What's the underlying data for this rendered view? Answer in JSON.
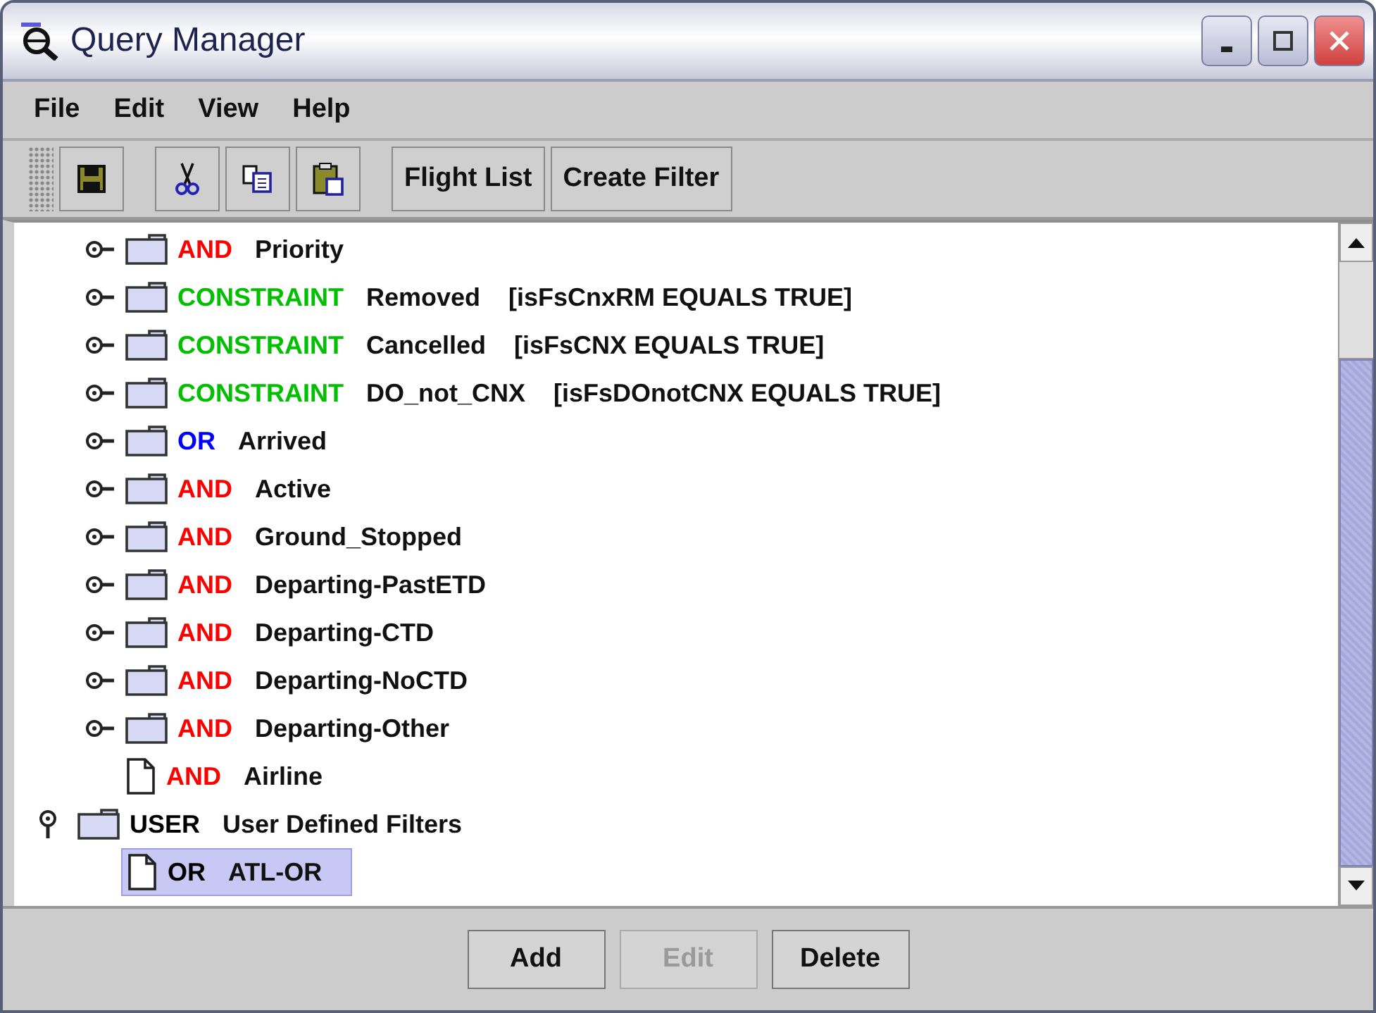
{
  "window": {
    "title": "Query Manager"
  },
  "menu": [
    {
      "label": "File"
    },
    {
      "label": "Edit"
    },
    {
      "label": "View"
    },
    {
      "label": "Help"
    }
  ],
  "toolbar": {
    "text_buttons": [
      "Flight List",
      "Create Filter"
    ]
  },
  "tree": {
    "nodes": [
      {
        "kind": "hidden",
        "children": [
          {
            "kind": "folder",
            "operator": "AND",
            "color": "#ff0000",
            "label": "Priority",
            "expanded": false,
            "selected": false
          },
          {
            "kind": "folder",
            "operator": "CONSTRAINT",
            "color": "#00c000",
            "label": "Removed",
            "condition": "[isFsCnxRM EQUALS TRUE]",
            "expanded": false,
            "selected": false
          },
          {
            "kind": "folder",
            "operator": "CONSTRAINT",
            "color": "#00c000",
            "label": "Cancelled",
            "condition": "[isFsCNX EQUALS TRUE]",
            "expanded": false,
            "selected": false
          },
          {
            "kind": "folder",
            "operator": "CONSTRAINT",
            "color": "#00c000",
            "label": "DO_not_CNX",
            "condition": "[isFsDOnotCNX EQUALS TRUE]",
            "expanded": false,
            "selected": false
          },
          {
            "kind": "folder",
            "operator": "OR",
            "color": "#0000ff",
            "label": "Arrived",
            "expanded": false,
            "selected": false
          },
          {
            "kind": "folder",
            "operator": "AND",
            "color": "#ff0000",
            "label": "Active",
            "expanded": false,
            "selected": false
          },
          {
            "kind": "folder",
            "operator": "AND",
            "color": "#ff0000",
            "label": "Ground_Stopped",
            "expanded": false,
            "selected": false
          },
          {
            "kind": "folder",
            "operator": "AND",
            "color": "#ff0000",
            "label": "Departing-PastETD",
            "expanded": false,
            "selected": false
          },
          {
            "kind": "folder",
            "operator": "AND",
            "color": "#ff0000",
            "label": "Departing-CTD",
            "expanded": false,
            "selected": false
          },
          {
            "kind": "folder",
            "operator": "AND",
            "color": "#ff0000",
            "label": "Departing-NoCTD",
            "expanded": false,
            "selected": false
          },
          {
            "kind": "folder",
            "operator": "AND",
            "color": "#ff0000",
            "label": "Departing-Other",
            "expanded": false,
            "selected": false
          },
          {
            "kind": "document",
            "operator": "AND",
            "color": "#ff0000",
            "label": "Airline",
            "selected": false
          }
        ]
      },
      {
        "kind": "folder",
        "operator": "USER",
        "color": "#000000",
        "label": "User Defined Filters",
        "expanded": true,
        "selected": false,
        "children": [
          {
            "kind": "document",
            "operator": "OR",
            "color": "#000000",
            "label": "ATL-OR",
            "selected": true
          }
        ]
      }
    ]
  },
  "buttons": [
    {
      "label": "Add",
      "disabled": false
    },
    {
      "label": "Edit",
      "disabled": true
    },
    {
      "label": "Delete",
      "disabled": false
    }
  ]
}
